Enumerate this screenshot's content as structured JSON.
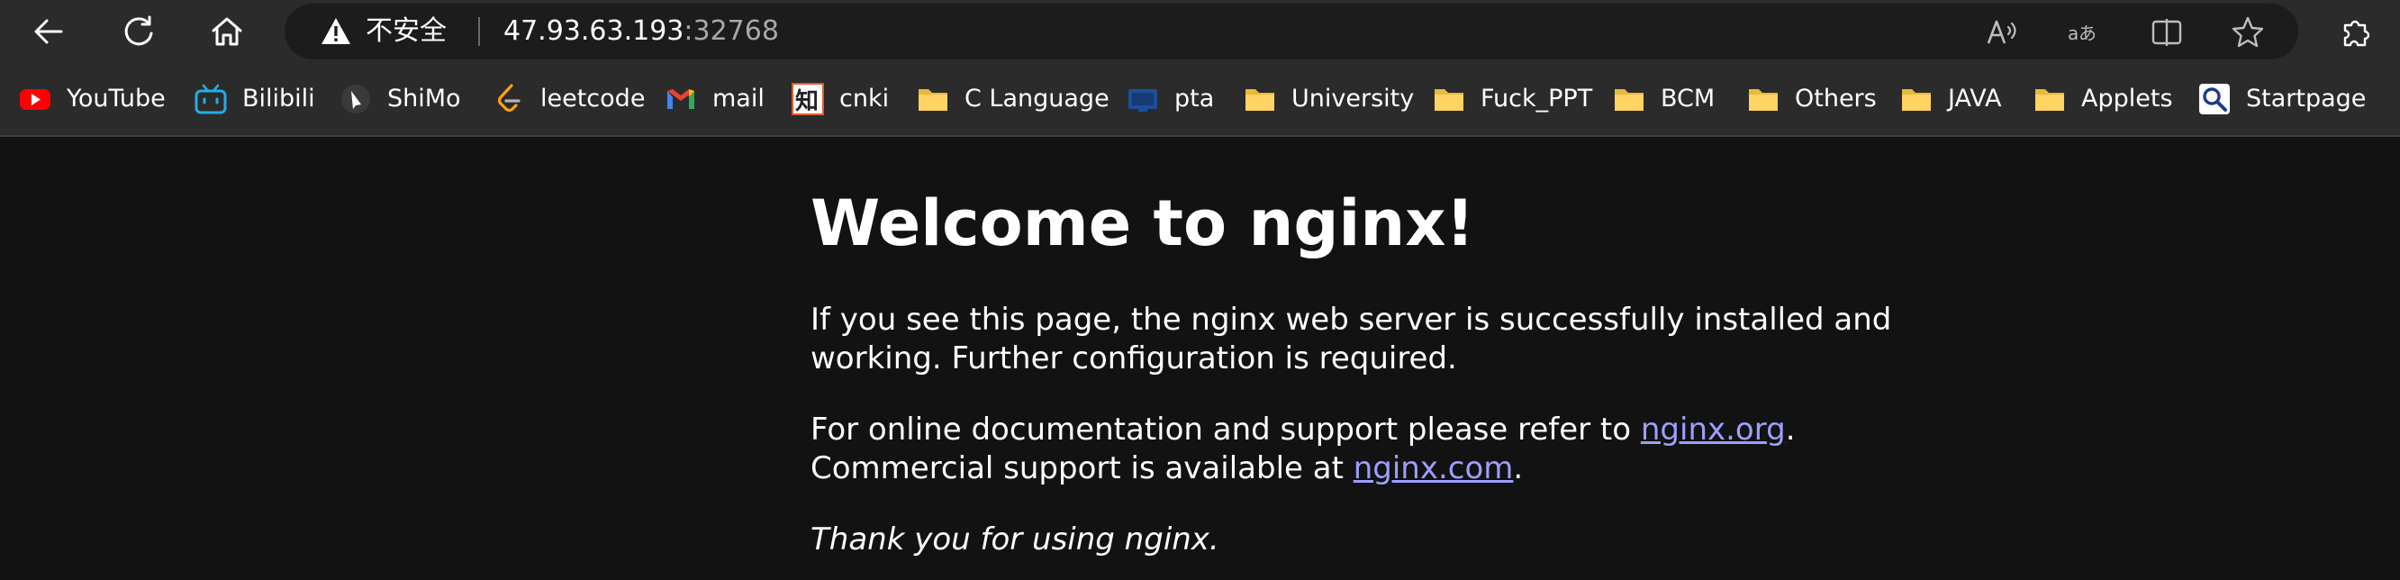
{
  "browser": {
    "security_label": "不安全",
    "url_host": "47.93.63.193",
    "url_port": ":32768",
    "nav_icons": [
      "back-arrow-icon",
      "reload-icon",
      "home-icon"
    ],
    "address_icons": [
      "read-aloud-icon",
      "translate-icon",
      "split-screen-icon",
      "favorite-star-icon"
    ],
    "extension_icon": "extensions-puzzle-icon"
  },
  "bookmarks": [
    {
      "label": "YouTube",
      "icon": "youtube-icon"
    },
    {
      "label": "Bilibili",
      "icon": "bilibili-icon"
    },
    {
      "label": "ShiMo",
      "icon": "shimo-icon"
    },
    {
      "label": "leetcode",
      "icon": "leetcode-icon"
    },
    {
      "label": "mail",
      "icon": "gmail-icon"
    },
    {
      "label": "cnki",
      "icon": "cnki-icon"
    },
    {
      "label": "C Language",
      "icon": "folder-icon"
    },
    {
      "label": "pta",
      "icon": "pta-icon"
    },
    {
      "label": "University",
      "icon": "folder-icon"
    },
    {
      "label": "Fuck_PPT",
      "icon": "folder-icon"
    },
    {
      "label": "BCM",
      "icon": "folder-icon"
    },
    {
      "label": "Others",
      "icon": "folder-icon"
    },
    {
      "label": "JAVA",
      "icon": "folder-icon"
    },
    {
      "label": "Applets",
      "icon": "folder-icon"
    },
    {
      "label": "Startpage",
      "icon": "startpage-icon"
    }
  ],
  "page": {
    "heading": "Welcome to nginx!",
    "p1": "If you see this page, the nginx web server is successfully installed and working. Further configuration is required.",
    "p2_prefix": "For online documentation and support please refer to ",
    "p2_link": "nginx.org",
    "p2_mid": ".",
    "p2_line2_prefix": "Commercial support is available at ",
    "p2_link2": "nginx.com",
    "p2_end": ".",
    "p3": "Thank you for using nginx.",
    "link_color": "#9e9eff",
    "background": "#121212"
  }
}
